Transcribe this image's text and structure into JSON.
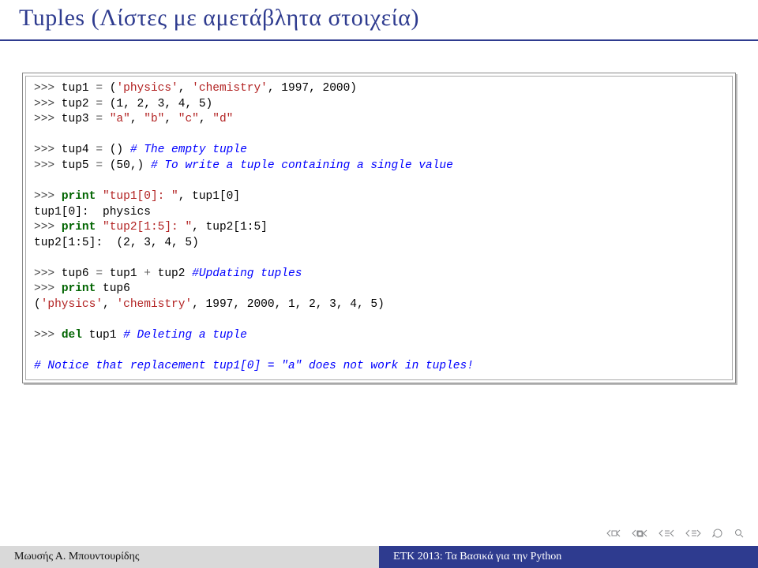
{
  "title": "Tuples (Λίστες με αμετάβλητα στοιχεία)",
  "code": {
    "l1": ">>> tup1 = ('physics', 'chemistry', 1997, 2000)",
    "l2": ">>> tup2 = (1, 2, 3, 4, 5)",
    "l3": ">>> tup3 = \"a\", \"b\", \"c\", \"d\"",
    "l4": "",
    "l5": ">>> tup4 = () # The empty tuple",
    "l6": ">>> tup5 = (50,) # To write a tuple containing a single value",
    "l7": "",
    "l8": ">>> print \"tup1[0]: \", tup1[0]",
    "l9": "tup1[0]:  physics",
    "l10": ">>> print \"tup2[1:5]: \", tup2[1:5]",
    "l11": "tup2[1:5]:  (2, 3, 4, 5)",
    "l12": "",
    "l13": ">>> tup6 = tup1 + tup2 #Updating tuples",
    "l14": ">>> print tup6",
    "l15": "('physics', 'chemistry', 1997, 2000, 1, 2, 3, 4, 5)",
    "l16": "",
    "l17": ">>> del tup1 # Deleting a tuple",
    "l18": "",
    "l19": "# Notice that replacement tup1[0] = \"a\" does not work in tuples!"
  },
  "footer": {
    "left": "Μωυσής Α. Μπουντουρίδης",
    "right": "ΕΤΚ 2013: Τα Βασικά για την Python"
  }
}
